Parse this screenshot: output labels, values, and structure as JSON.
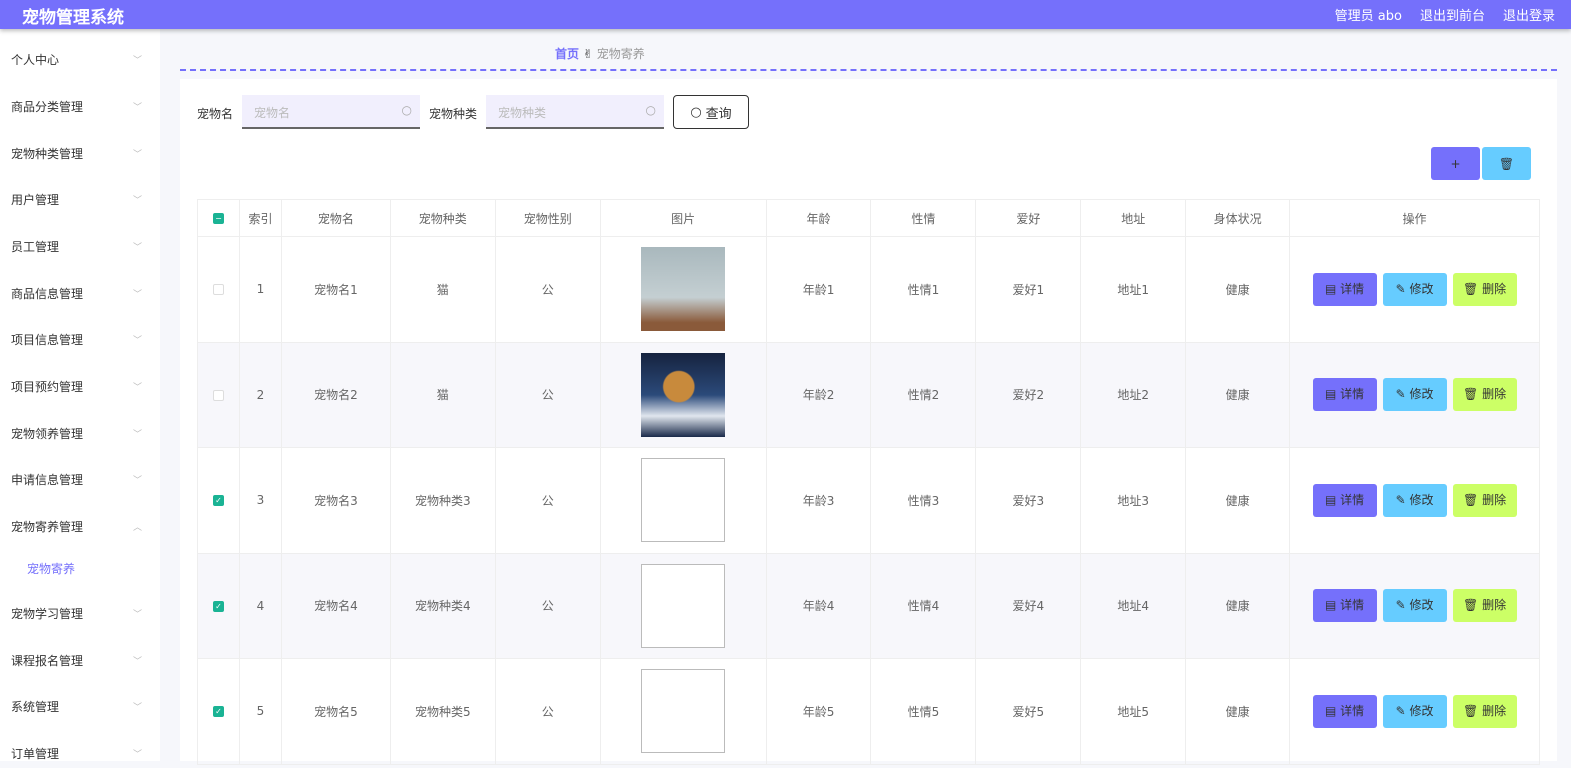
{
  "header": {
    "title": "宠物管理系统",
    "user": "管理员 abo",
    "front": "退出到前台",
    "logout": "退出登录"
  },
  "sidebar": {
    "items": [
      "个人中心",
      "商品分类管理",
      "宠物种类管理",
      "用户管理",
      "员工管理",
      "商品信息管理",
      "项目信息管理",
      "项目预约管理",
      "宠物领养管理",
      "申请信息管理",
      "宠物寄养管理"
    ],
    "sub": "宠物寄养",
    "items2": [
      "宠物学习管理",
      "课程报名管理",
      "系统管理",
      "订单管理"
    ]
  },
  "breadcrumb": {
    "home": "首页",
    "current": "宠物寄养"
  },
  "search": {
    "name_label": "宠物名",
    "name_placeholder": "宠物名",
    "kind_label": "宠物种类",
    "kind_placeholder": "宠物种类",
    "query": "查询"
  },
  "table": {
    "headers": [
      "索引",
      "宠物名",
      "宠物种类",
      "宠物性别",
      "图片",
      "年龄",
      "性情",
      "爱好",
      "地址",
      "身体状况",
      "操作"
    ],
    "rows": [
      {
        "checked": false,
        "cells": [
          "1",
          "宠物名1",
          "猫",
          "公",
          "",
          "年龄1",
          "性情1",
          "爱好1",
          "地址1",
          "健康"
        ],
        "image": "white-cat"
      },
      {
        "checked": false,
        "cells": [
          "2",
          "宠物名2",
          "猫",
          "公",
          "",
          "年龄2",
          "性情2",
          "爱好2",
          "地址2",
          "健康"
        ],
        "image": "orange-cat"
      },
      {
        "checked": true,
        "cells": [
          "3",
          "宠物名3",
          "宠物种类3",
          "公",
          "",
          "年龄3",
          "性情3",
          "爱好3",
          "地址3",
          "健康"
        ],
        "image": "broken"
      },
      {
        "checked": true,
        "cells": [
          "4",
          "宠物名4",
          "宠物种类4",
          "公",
          "",
          "年龄4",
          "性情4",
          "爱好4",
          "地址4",
          "健康"
        ],
        "image": "broken"
      },
      {
        "checked": true,
        "cells": [
          "5",
          "宠物名5",
          "宠物种类5",
          "公",
          "",
          "年龄5",
          "性情5",
          "爱好5",
          "地址5",
          "健康"
        ],
        "image": "broken"
      }
    ],
    "actions": {
      "detail": "详情",
      "edit": "修改",
      "delete": "删除"
    }
  },
  "colors": {
    "primary": "#7570fb",
    "info": "#66ccff",
    "warn": "#ccff66",
    "check": "#1ab394"
  }
}
